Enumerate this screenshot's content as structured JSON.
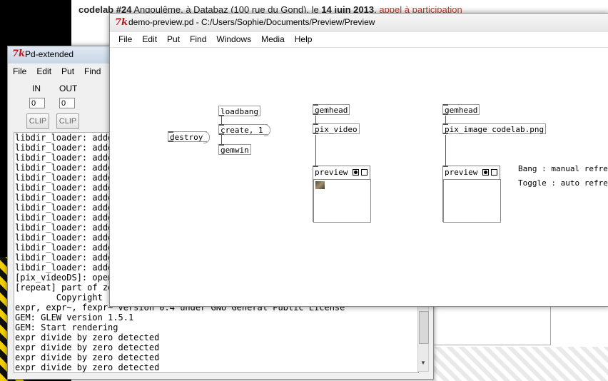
{
  "background": {
    "headline_bold": "codelab #24",
    "headline_rest": " Angoulême, à Databaz (100 rue du Gond), le ",
    "headline_date": "14 juin 2013",
    "headline_sep": ", ",
    "headline_link": "appel à participation"
  },
  "pd_window": {
    "logo": "7k",
    "title": "Pd-extended",
    "menu": [
      "File",
      "Edit",
      "Put",
      "Find"
    ],
    "in_label": "IN",
    "out_label": "OUT",
    "in_value": "0",
    "out_value": "0",
    "clip_label": "CLIP",
    "console": [
      "libdir_loader: adde",
      "libdir_loader: adde",
      "libdir_loader: adde",
      "libdir_loader: adde",
      "libdir_loader: adde",
      "libdir_loader: adde",
      "libdir_loader: adde",
      "libdir_loader: adde",
      "libdir_loader: adde",
      "libdir_loader: adde",
      "libdir_loader: adde",
      "libdir_loader: adde",
      "libdir_loader: adde",
      "libdir_loader: adde",
      "[pix_videoDS]: open",
      "[repeat] part of ze",
      "        Copyright (",
      "expr, expr~, fexpr~ version 0.4 under GNU General Public License",
      "GEM: GLEW version 1.5.1",
      "GEM: Start rendering",
      "expr divide by zero detected",
      "expr divide by zero detected",
      "expr divide by zero detected",
      "expr divide by zero detected"
    ]
  },
  "patch_window": {
    "logo": "7k",
    "title": "demo-preview.pd  - C:/Users/Sophie/Documents/Preview/Preview",
    "menu": [
      "File",
      "Edit",
      "Put",
      "Find",
      "Windows",
      "Media",
      "Help"
    ],
    "objects": {
      "loadbang": "loadbang",
      "create": "create, 1",
      "gemwin": "gemwin",
      "destroy": "destroy",
      "gemhead_1": "gemhead",
      "pix_video": "pix_video",
      "gemhead_2": "gemhead",
      "pix_image": "pix_image codelab.png"
    },
    "subpatches": {
      "preview_1": "preview",
      "preview_2": "preview"
    },
    "comments": {
      "bang": "Bang : manual refresh",
      "toggle": "Toggle : auto refresh"
    }
  }
}
